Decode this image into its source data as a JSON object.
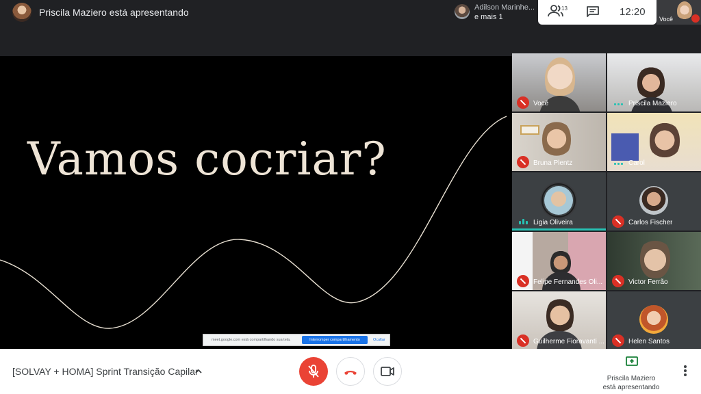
{
  "topbar": {
    "presenter_title": "Priscila Maziero está apresentando",
    "joined": {
      "name": "Adilson Marinhe...",
      "more": "e mais 1"
    },
    "people_count": "13",
    "clock": "12:20",
    "self_label": "Você"
  },
  "slide": {
    "title": "Vamos cocriar?",
    "share_bar": {
      "message": "meet.google.com está compartilhando sua tela.",
      "stop_label": "Interromper compartilhamento",
      "hide_label": "Ocultar"
    }
  },
  "participants": [
    {
      "name": "Você",
      "mic": "off"
    },
    {
      "name": "Priscila Maziero",
      "mic": "on"
    },
    {
      "name": "Bruna Plentz",
      "mic": "off"
    },
    {
      "name": "Carol",
      "mic": "on"
    },
    {
      "name": "Ligia Oliveira",
      "mic": "speaking"
    },
    {
      "name": "Carlos Fischer",
      "mic": "off"
    },
    {
      "name": "Felipe Fernandes Oli...",
      "mic": "off"
    },
    {
      "name": "Victor Ferrão",
      "mic": "off"
    },
    {
      "name": "Guilherme Fioravanti ...",
      "mic": "off"
    },
    {
      "name": "Helen Santos",
      "mic": "off"
    }
  ],
  "bottombar": {
    "meeting_title": "[SOLVAY + HOMA] Sprint Transição Capilar",
    "presenter_name": "Priscila Maziero",
    "presenter_status": "está apresentando"
  },
  "colors": {
    "accent_red": "#ea4335",
    "speaking_teal": "#27c2b4",
    "present_green": "#188038"
  }
}
